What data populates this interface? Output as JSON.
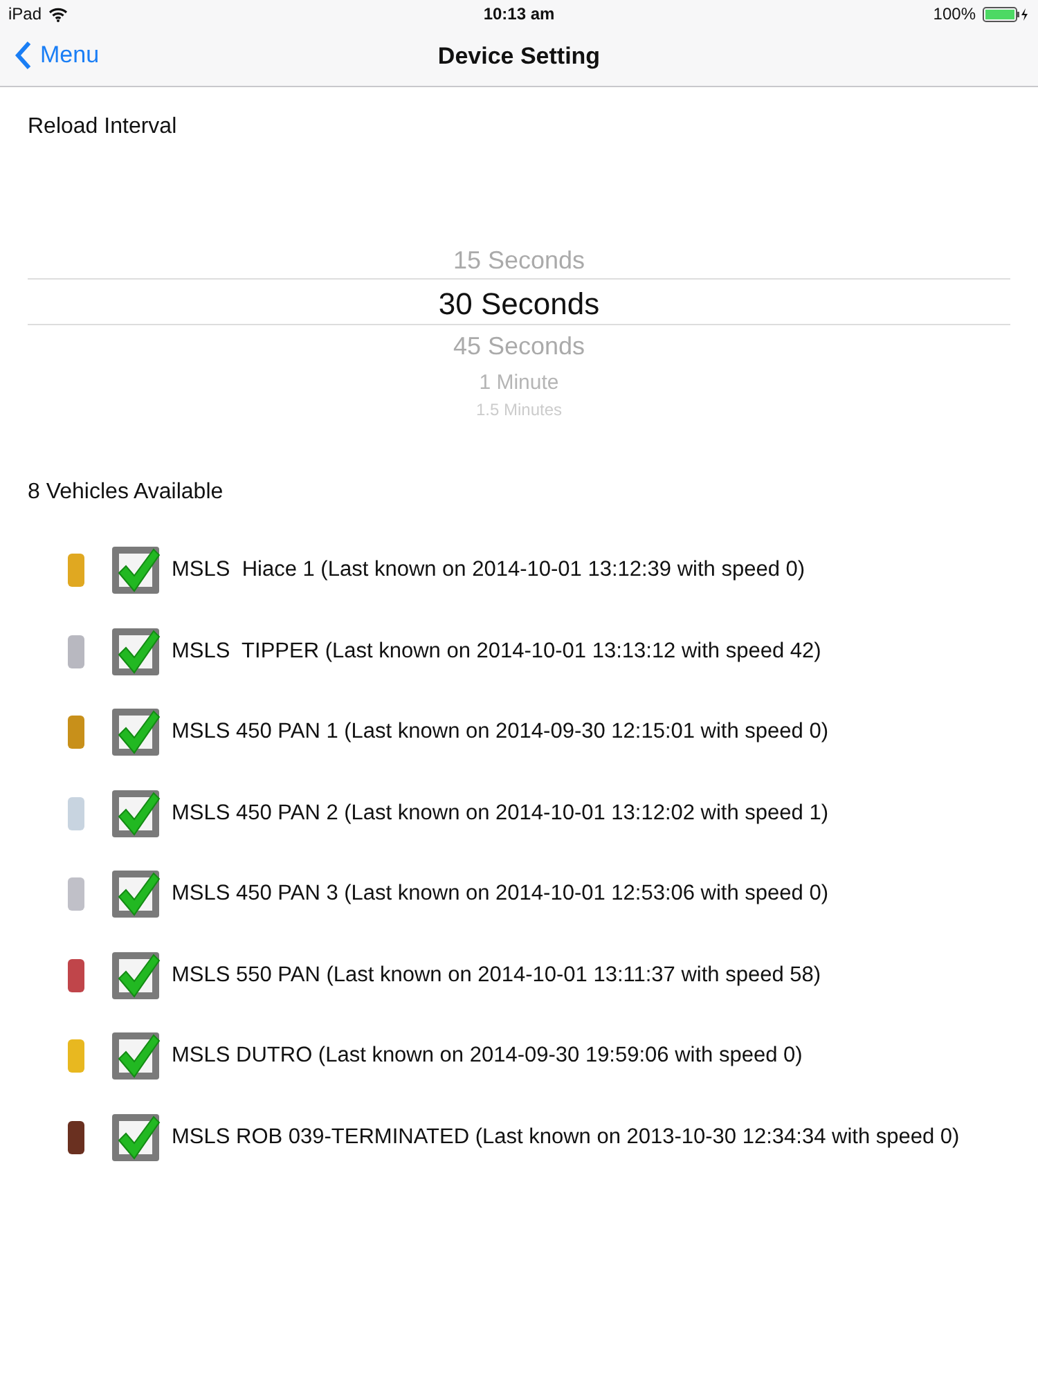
{
  "status_bar": {
    "carrier": "iPad",
    "time": "10:13 am",
    "battery": "100%"
  },
  "nav": {
    "back": "Menu",
    "title": "Device Setting"
  },
  "reload_interval": {
    "label": "Reload Interval",
    "options": [
      {
        "label": "15 Seconds",
        "selected": false
      },
      {
        "label": "30 Seconds",
        "selected": true
      },
      {
        "label": "45 Seconds",
        "selected": false
      },
      {
        "label": "1 Minute",
        "selected": false
      },
      {
        "label": "1.5 Minutes",
        "selected": false
      }
    ]
  },
  "vehicles": {
    "heading": "8 Vehicles Available",
    "items": [
      {
        "label": "MSLS  Hiace 1 (Last known on 2014-10-01 13:12:39 with speed 0)",
        "checked": true,
        "color": "#e0a821"
      },
      {
        "label": "MSLS  TIPPER (Last known on 2014-10-01 13:13:12 with speed 42)",
        "checked": true,
        "color": "#b8b8c0"
      },
      {
        "label": "MSLS 450 PAN 1 (Last known on 2014-09-30 12:15:01 with speed 0)",
        "checked": true,
        "color": "#c8901a"
      },
      {
        "label": "MSLS 450 PAN 2 (Last known on 2014-10-01 13:12:02 with speed 1)",
        "checked": true,
        "color": "#c8d4e0"
      },
      {
        "label": "MSLS 450 PAN 3 (Last known on 2014-10-01 12:53:06 with speed 0)",
        "checked": true,
        "color": "#c0c0c8"
      },
      {
        "label": "MSLS 550 PAN (Last known on 2014-10-01 13:11:37 with speed 58)",
        "checked": true,
        "color": "#c0454a"
      },
      {
        "label": "MSLS DUTRO (Last known on 2014-09-30 19:59:06 with speed 0)",
        "checked": true,
        "color": "#e8b820"
      },
      {
        "label": "MSLS ROB 039-TERMINATED (Last known on 2013-10-30 12:34:34 with speed 0)",
        "checked": true,
        "color": "#6a3020"
      }
    ]
  }
}
